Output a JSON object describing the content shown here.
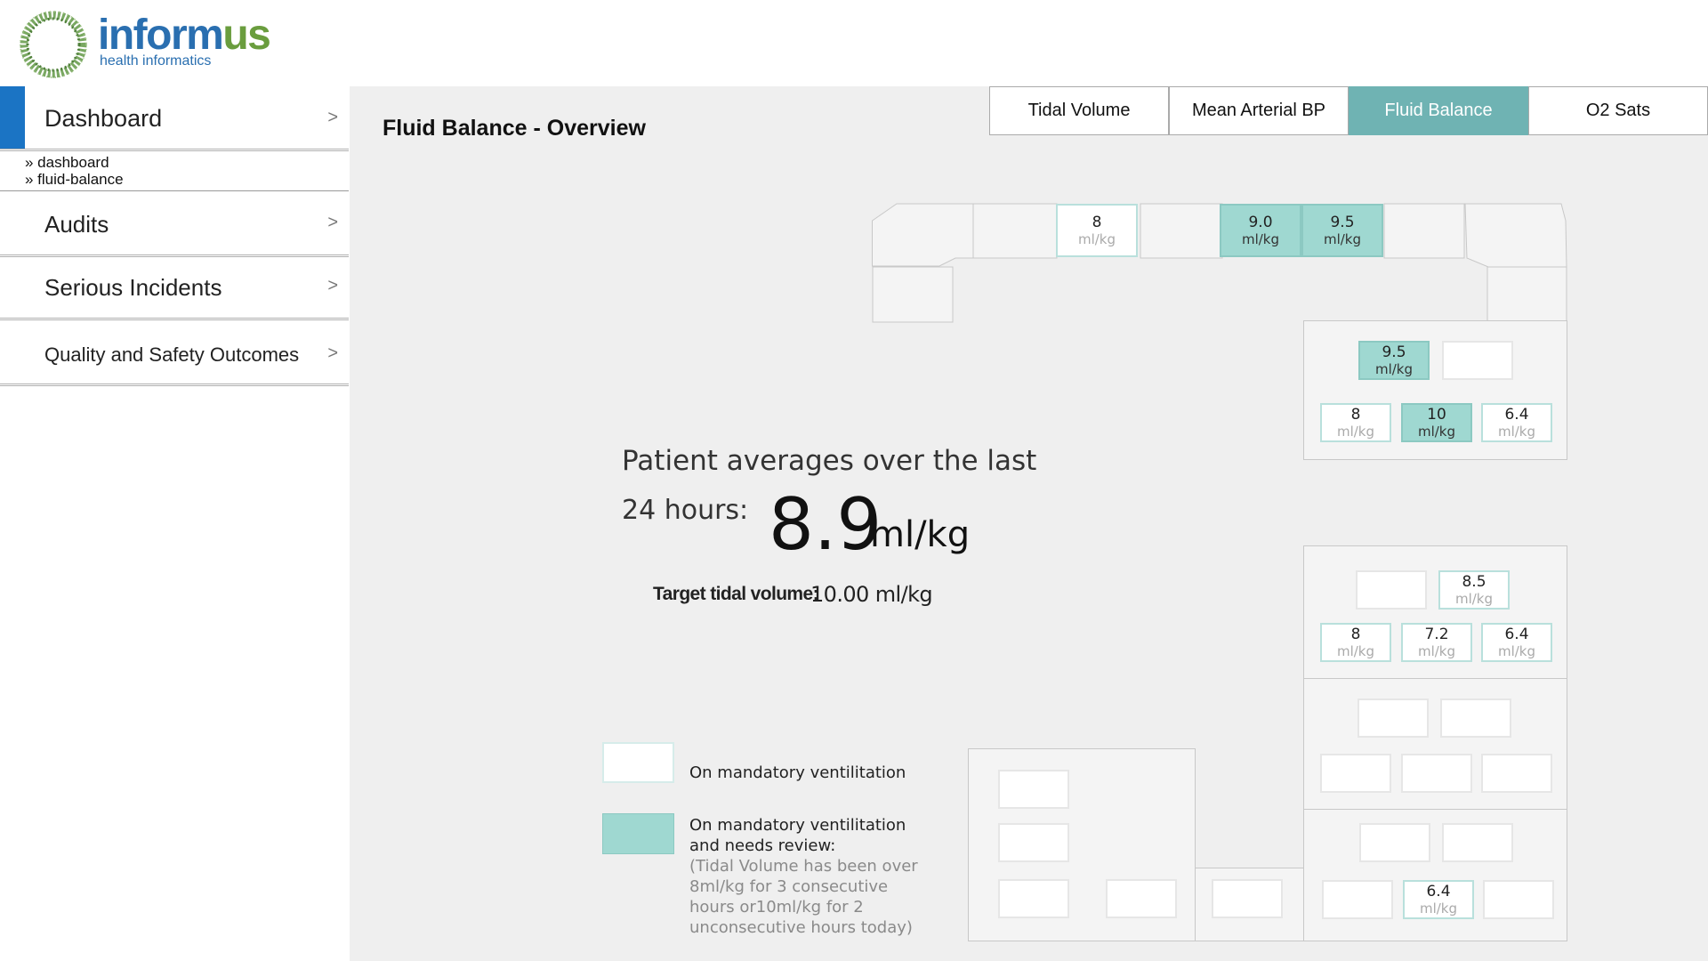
{
  "header": {
    "logo_main": "inform",
    "logo_accent": "us",
    "logo_tagline": "health informatics"
  },
  "sidebar": {
    "items": [
      {
        "label": "Dashboard",
        "chevron": ">"
      },
      {
        "label": "Audits",
        "chevron": ">"
      },
      {
        "label": "Serious Incidents",
        "chevron": ">"
      },
      {
        "label": "Quality and Safety Outcomes",
        "chevron": ">"
      }
    ],
    "breadcrumbs": [
      "» dashboard",
      "» fluid-balance"
    ]
  },
  "main": {
    "title": "Fluid Balance - Overview",
    "tabs": [
      {
        "label": "Tidal Volume",
        "active": false
      },
      {
        "label": "Mean Arterial BP",
        "active": false
      },
      {
        "label": "Fluid Balance",
        "active": true
      },
      {
        "label": "O2 Sats",
        "active": false
      }
    ]
  },
  "stats": {
    "avg_line1": "Patient averages over the last",
    "avg_line2": "24 hours:",
    "avg_value": "8.9",
    "avg_unit": "ml/kg",
    "target_label": "Target tidal volume:",
    "target_value": "10.00 ml/kg"
  },
  "legend": {
    "ventilation": "On mandatory ventilitation",
    "review_line1": "On mandatory ventilitation",
    "review_line2": "and needs review:",
    "review_note": "(Tidal Volume has been over 8ml/kg for 3 consecutive hours or10ml/kg for 2 unconsecutive hours today)"
  },
  "beds": {
    "unit": "ml/kg",
    "top": [
      "8",
      "9.0",
      "9.5"
    ],
    "bay1": [
      "9.5",
      "8",
      "10",
      "6.4"
    ],
    "bay2": [
      "8.5",
      "8",
      "7.2",
      "6.4"
    ],
    "bay4": [
      "6.4"
    ]
  },
  "colors": {
    "accent_blue": "#1b74c4",
    "review_teal": "#9fd8d1",
    "tab_active": "#6fb3b3",
    "logo_blue": "#2a6fb0",
    "logo_green": "#6a9d3e"
  }
}
